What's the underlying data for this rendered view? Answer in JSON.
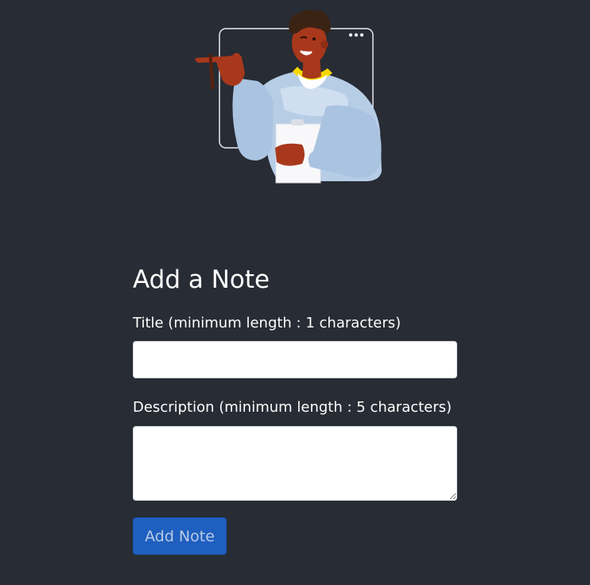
{
  "form": {
    "heading": "Add a Note",
    "title_label": "Title (minimum length : 1 characters)",
    "title_value": "",
    "description_label": "Description (minimum length : 5 characters)",
    "description_value": "",
    "submit_label": "Add Note"
  },
  "illustration": {
    "icon": "person-presenting-notes-illustration"
  },
  "colors": {
    "background": "#282c34",
    "button": "#1f5fbf",
    "button_text": "#b8cbe6"
  }
}
